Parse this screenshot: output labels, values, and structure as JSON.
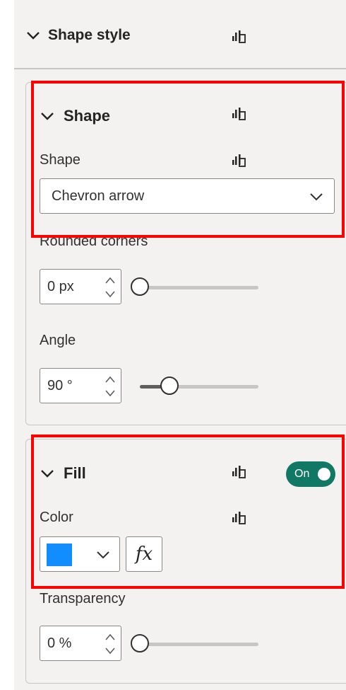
{
  "shape_style": {
    "title": "Shape style"
  },
  "shape_card": {
    "title": "Shape",
    "shape_label": "Shape",
    "shape_value": "Chevron arrow",
    "rounded_label": "Rounded corners",
    "rounded_value": "0 px",
    "rounded_fraction": 0.0,
    "angle_label": "Angle",
    "angle_value": "90 °",
    "angle_fraction": 0.25
  },
  "fill_card": {
    "title": "Fill",
    "toggle_label": "On",
    "toggle_state": true,
    "color_label": "Color",
    "fx_label": "fx",
    "transparency_label": "Transparency",
    "transparency_value": "0 %",
    "transparency_fraction": 0.0
  },
  "colors": {
    "fill_swatch": "#118dff",
    "toggle_on": "#117865",
    "highlight": "#ff0000"
  },
  "icons": {
    "chevron": "chevron-down-icon",
    "format": "conditional-format-icon"
  }
}
